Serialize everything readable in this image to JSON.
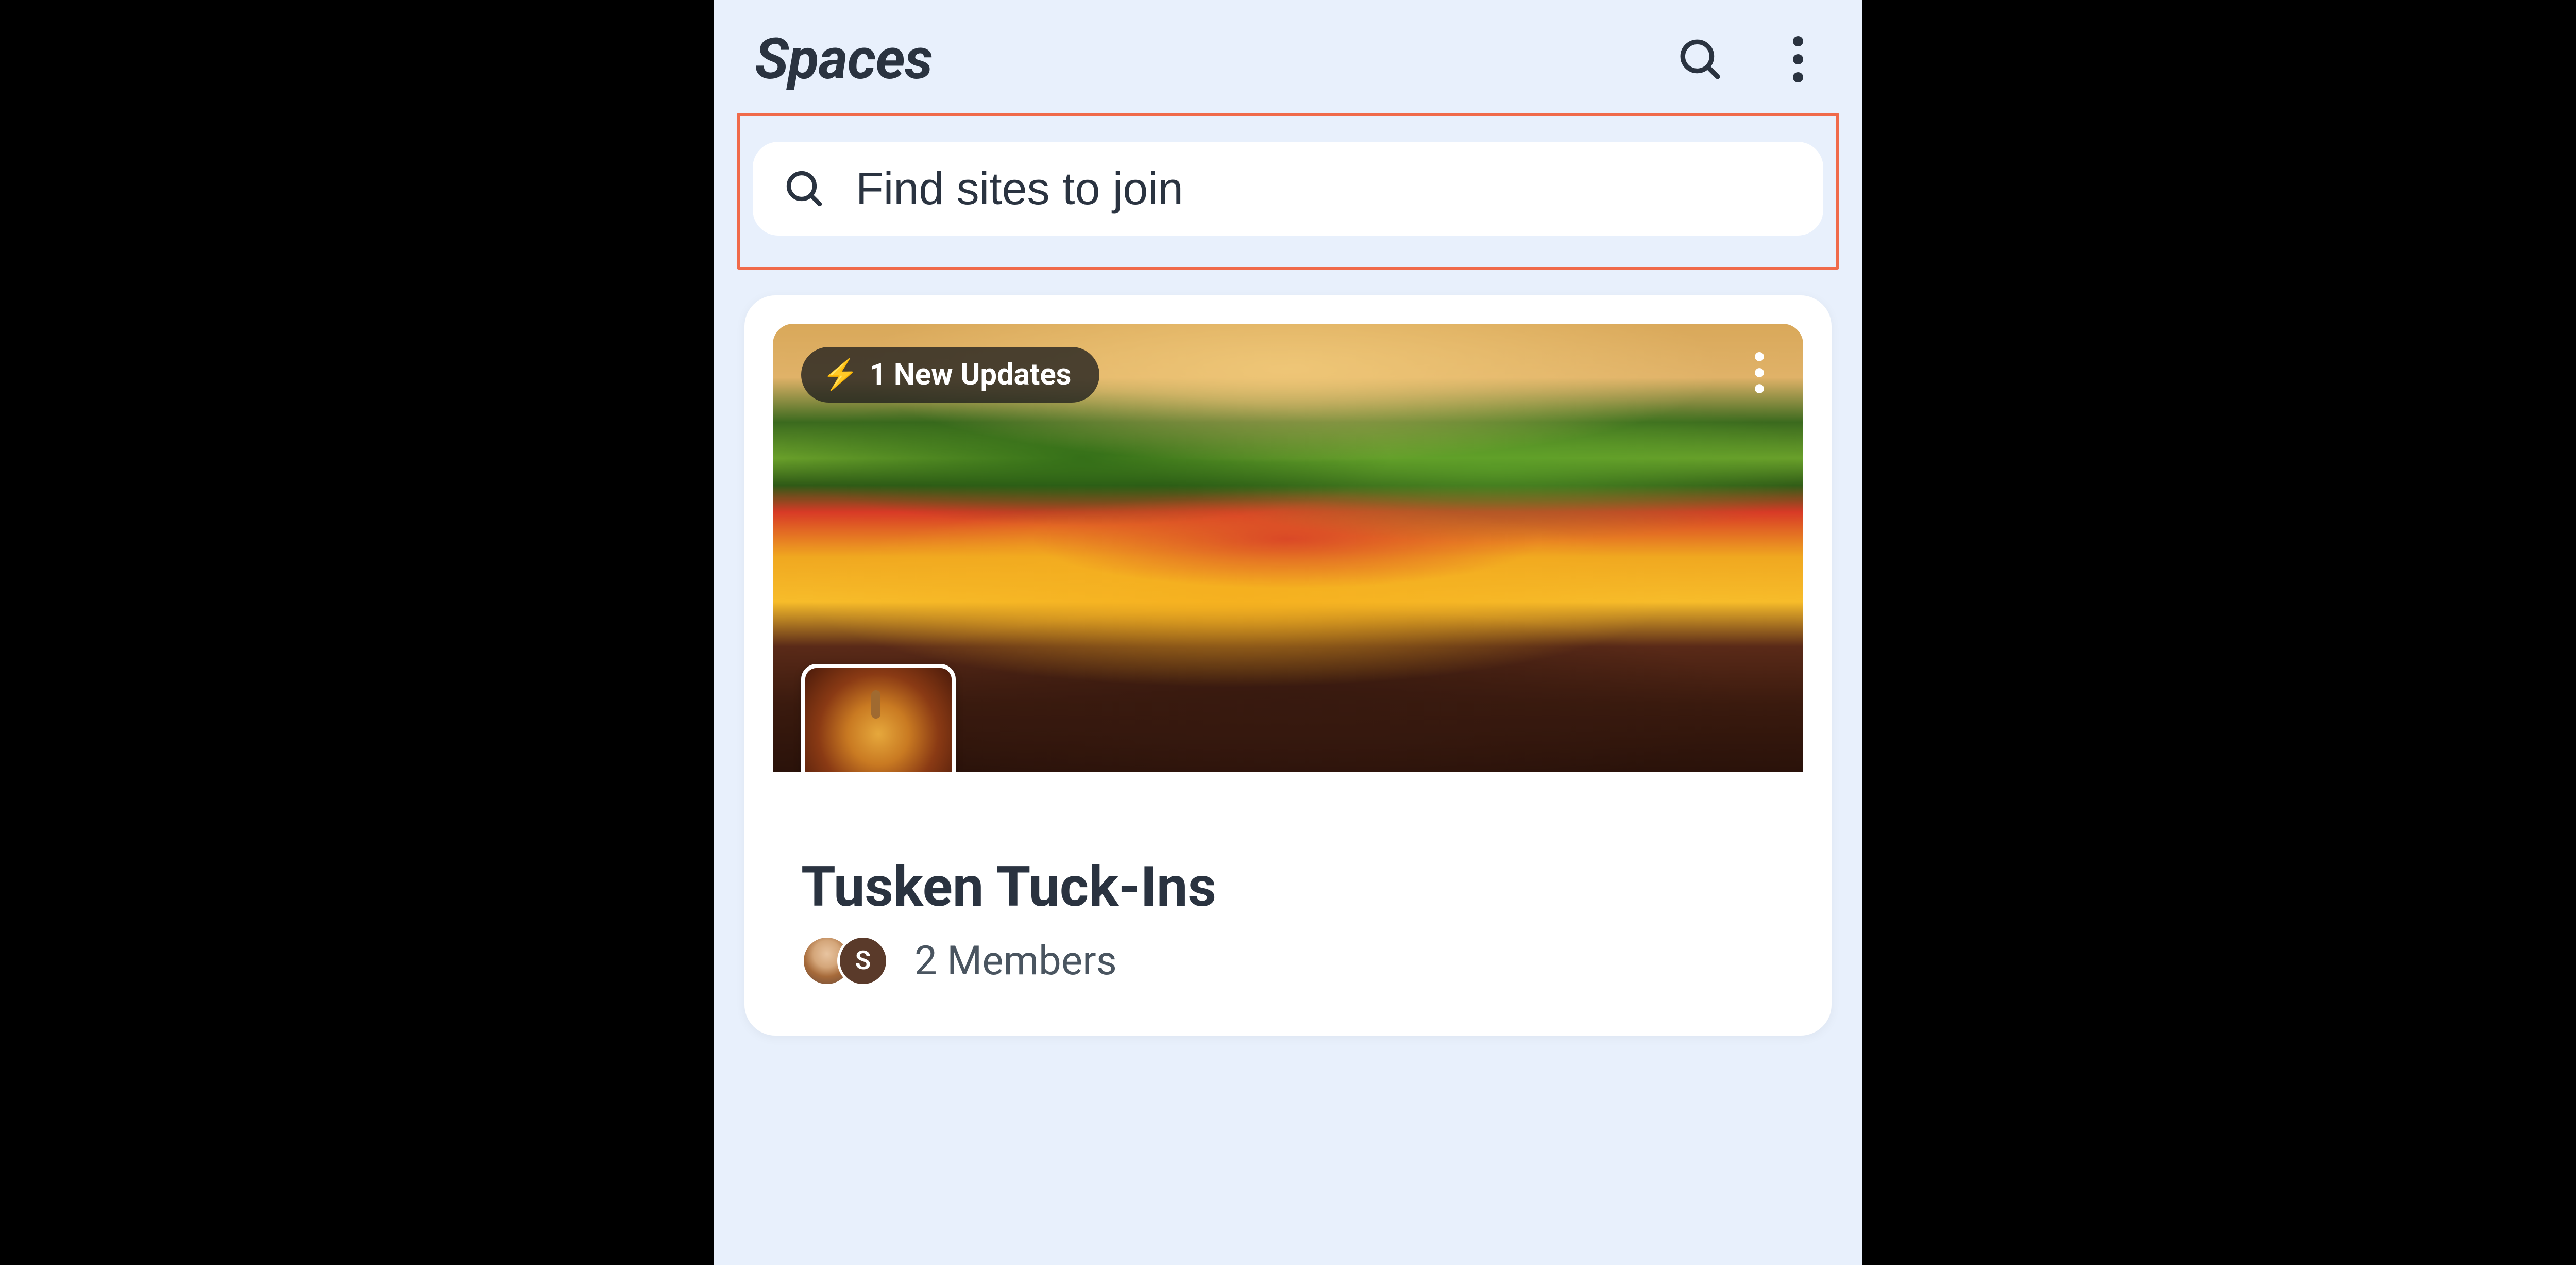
{
  "header": {
    "title": "Spaces"
  },
  "search": {
    "placeholder": "Find sites to join"
  },
  "card": {
    "updates_label": "1 New Updates",
    "title": "Tusken Tuck-Ins",
    "members_label": "2 Members",
    "avatars": [
      {
        "type": "photo"
      },
      {
        "type": "letter",
        "initial": "S"
      }
    ]
  },
  "icons": {
    "bolt": "⚡"
  }
}
